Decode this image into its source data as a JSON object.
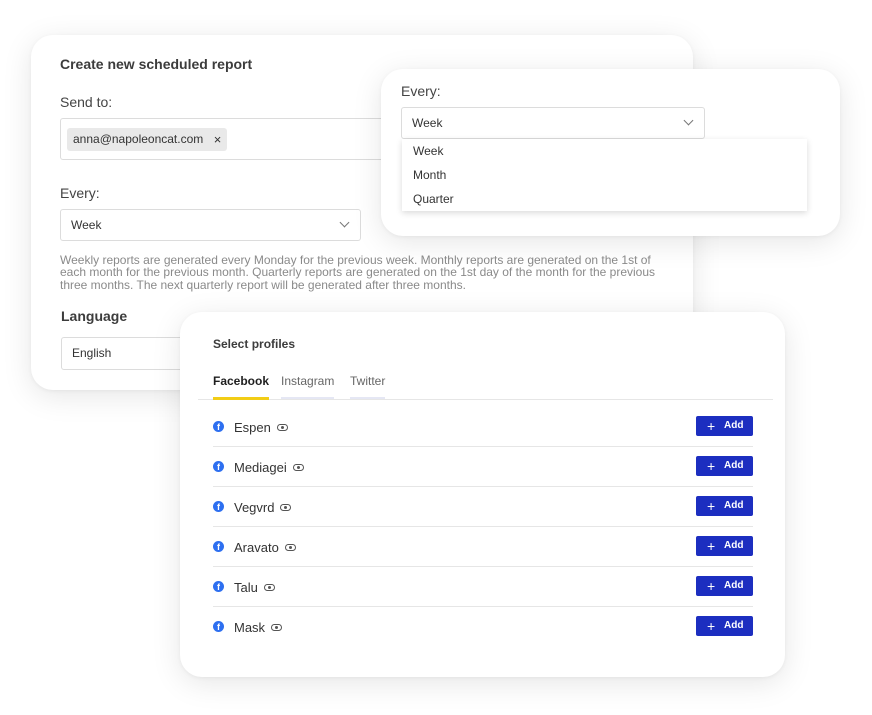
{
  "report": {
    "title": "Create new scheduled report",
    "send_label": "Send to:",
    "email_chip": "anna@napoleoncat.com",
    "chip_close": "×",
    "every_label": "Every:",
    "every_value": "Week",
    "description": "Weekly reports are generated every Monday for the previous week. Monthly reports are generated on the 1st of each month for the previous month. Quarterly reports are generated on the 1st day of the month for the previous three months. The next quarterly report will be generated after three months.",
    "language_label": "Language",
    "language_value": "English"
  },
  "every_dropdown": {
    "label": "Every:",
    "value": "Week",
    "options": [
      "Week",
      "Month",
      "Quarter"
    ]
  },
  "profiles": {
    "title": "Select profiles",
    "tabs": [
      "Facebook",
      "Instagram",
      "Twitter"
    ],
    "add_label": "Add",
    "add_plus": "+",
    "fb_glyph": "f",
    "items": [
      "Espen",
      "Mediagei",
      "Vegvrd",
      "Aravato",
      "Talu",
      "Mask"
    ]
  },
  "colors": {
    "accent_button": "#1c2ec0",
    "active_tab": "#f2cd16",
    "facebook": "#2d6ff0"
  }
}
